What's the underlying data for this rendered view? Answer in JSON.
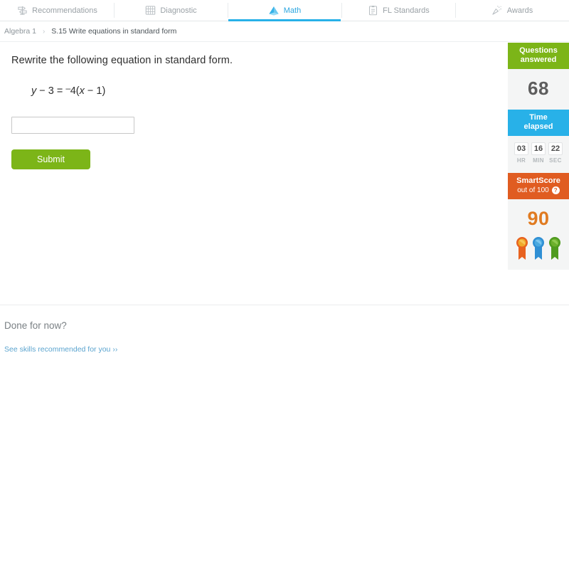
{
  "nav": {
    "tabs": [
      {
        "label": "Recommendations",
        "icon": "signpost-icon",
        "active": false
      },
      {
        "label": "Diagnostic",
        "icon": "abacus-icon",
        "active": false
      },
      {
        "label": "Math",
        "icon": "pyramid-icon",
        "active": true
      },
      {
        "label": "FL Standards",
        "icon": "clipboard-icon",
        "active": false
      },
      {
        "label": "Awards",
        "icon": "party-popper-icon",
        "active": false
      }
    ]
  },
  "breadcrumb": {
    "course": "Algebra 1",
    "separator": "›",
    "skill": "S.15 Write equations in standard form"
  },
  "question": {
    "prompt": "Rewrite the following equation in standard form.",
    "equation": {
      "lhs_var": "y",
      "lhs_text": " − 3 = ",
      "neg_sign": "–",
      "coefficient": "4(",
      "inner_var": "x",
      "tail": " − 1)"
    },
    "answer_value": "",
    "answer_placeholder": "",
    "submit_label": "Submit"
  },
  "stats": {
    "questions": {
      "header_line1": "Questions",
      "header_line2": "answered",
      "value": "68"
    },
    "time": {
      "header_line1": "Time",
      "header_line2": "elapsed",
      "hours": "03",
      "minutes": "16",
      "seconds": "22",
      "hours_label": "HR",
      "minutes_label": "MIN",
      "seconds_label": "SEC"
    },
    "smartscore": {
      "header": "SmartScore",
      "subheader": "out of 100",
      "help_glyph": "?",
      "value": "90",
      "ribbons": [
        "#f0a92b",
        "#49a9e0",
        "#6cb02c"
      ],
      "ribbon_tails": [
        "#e8621f",
        "#2f8fd4",
        "#4f9b1f"
      ]
    }
  },
  "footer": {
    "done_title": "Done for now?",
    "recommend_link": "See skills recommended for you ››"
  },
  "colors": {
    "green": "#7cb518",
    "blue": "#28b1e8",
    "orange": "#e05c21",
    "score_orange": "#e07b21",
    "panel_bg": "#f4f5f5",
    "link_blue": "#5ba4cf"
  }
}
